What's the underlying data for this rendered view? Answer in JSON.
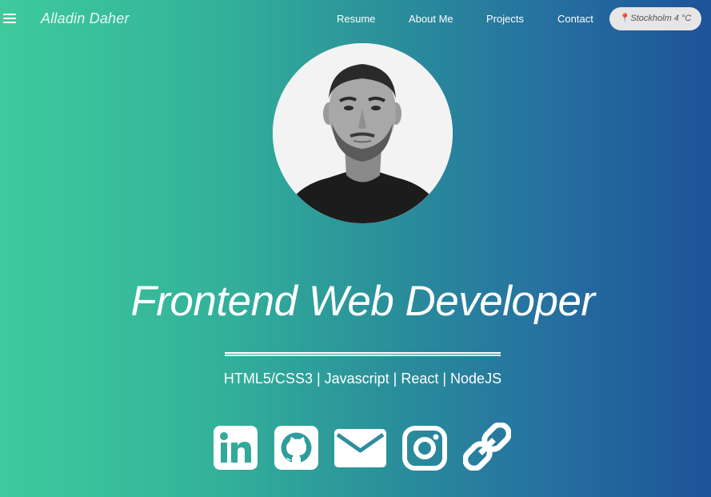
{
  "brand": {
    "name": "Alladin Daher"
  },
  "nav": {
    "items": [
      {
        "label": "Resume"
      },
      {
        "label": "About Me"
      },
      {
        "label": "Projects"
      },
      {
        "label": "Contact"
      }
    ]
  },
  "weather": {
    "icon": "map-pin-icon",
    "text": "Stockholm 4 °C"
  },
  "profile": {
    "photo": "profile-photo"
  },
  "hero": {
    "headline": "Frontend Web Developer",
    "skills": "HTML5/CSS3 | Javascript | React | NodeJS"
  },
  "social": [
    {
      "icon": "linkedin-icon"
    },
    {
      "icon": "github-icon"
    },
    {
      "icon": "mail-icon"
    },
    {
      "icon": "instagram-icon"
    },
    {
      "icon": "link-icon"
    }
  ],
  "colors": {
    "gradient_start": "#3ecb9c",
    "gradient_end": "#1e5399",
    "text": "#ffffff",
    "weather_pill": "#e6e6e6"
  }
}
